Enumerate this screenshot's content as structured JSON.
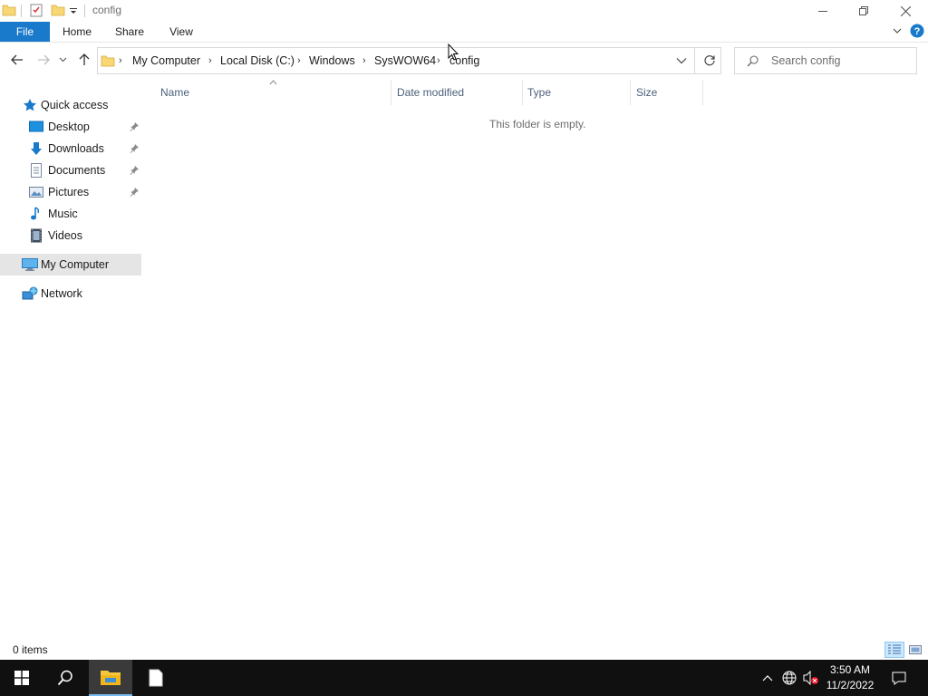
{
  "window": {
    "title": "config",
    "controls": {
      "minimize": "minimize-icon",
      "restore": "restore-icon",
      "close": "close-icon"
    }
  },
  "ribbon": {
    "tabs": [
      {
        "label": "File",
        "active": true
      },
      {
        "label": "Home"
      },
      {
        "label": "Share"
      },
      {
        "label": "View"
      }
    ]
  },
  "address": {
    "crumbs": [
      "My Computer",
      "Local Disk (C:)",
      "Windows",
      "SysWOW64",
      "config"
    ]
  },
  "search": {
    "placeholder": "Search config"
  },
  "nav": {
    "quick_access": "Quick access",
    "items": [
      {
        "label": "Desktop",
        "icon": "desktop-icon",
        "pinned": true
      },
      {
        "label": "Downloads",
        "icon": "downloads-icon",
        "pinned": true
      },
      {
        "label": "Documents",
        "icon": "documents-icon",
        "pinned": true
      },
      {
        "label": "Pictures",
        "icon": "pictures-icon",
        "pinned": true
      },
      {
        "label": "Music",
        "icon": "music-icon",
        "pinned": false
      },
      {
        "label": "Videos",
        "icon": "videos-icon",
        "pinned": false
      }
    ],
    "my_computer": "My Computer",
    "network": "Network"
  },
  "columns": [
    "Name",
    "Date modified",
    "Type",
    "Size"
  ],
  "content": {
    "empty_message": "This folder is empty."
  },
  "status": {
    "items": "0 items"
  },
  "taskbar": {
    "time": "3:50 AM",
    "date": "11/2/2022"
  },
  "colors": {
    "accent": "#1979ca",
    "selection": "#e5e5e5",
    "taskbar": "#101010",
    "folder": "#f8d775"
  }
}
